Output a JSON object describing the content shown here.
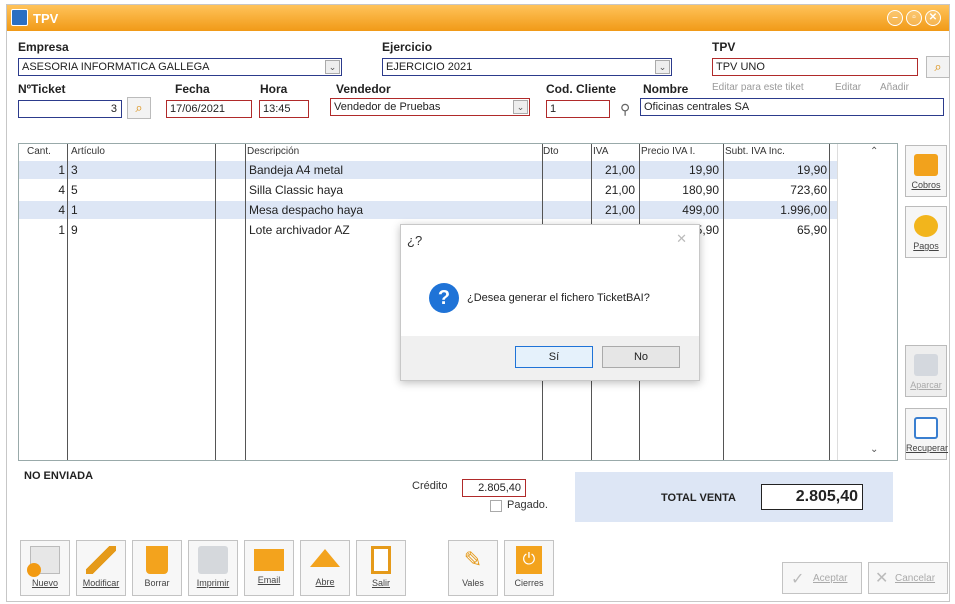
{
  "window": {
    "title": "TPV"
  },
  "header": {
    "empresa_label": "Empresa",
    "empresa_value": "ASESORIA INFORMATICA GALLEGA",
    "ejercicio_label": "Ejercicio",
    "ejercicio_value": "EJERCICIO 2021",
    "tpv_label": "TPV",
    "tpv_value": "TPV UNO",
    "ticket_label": "NºTicket",
    "ticket_value": "3",
    "fecha_label": "Fecha",
    "fecha_value": "17/06/2021",
    "hora_label": "Hora",
    "hora_value": "13:45",
    "vendedor_label": "Vendedor",
    "vendedor_value": "Vendedor de Pruebas",
    "cod_cliente_label": "Cod. Cliente",
    "cod_cliente_value": "1",
    "nombre_label": "Nombre",
    "nombre_value": "Oficinas centrales SA",
    "editar_tiket_label": "Editar para este tiket",
    "editar_label": "Editar",
    "anadir_label": "Añadir"
  },
  "table": {
    "headers": [
      "Cant.",
      "Artículo",
      "Descripción",
      "Dto",
      "IVA",
      "Precio IVA I.",
      "Subt. IVA Inc."
    ],
    "rows": [
      {
        "cant": "1",
        "articulo": "3",
        "descripcion": "Bandeja A4 metal",
        "dto": "",
        "iva": "21,00",
        "precio": "19,90",
        "subtotal": "19,90"
      },
      {
        "cant": "4",
        "articulo": "5",
        "descripcion": "Silla Classic haya",
        "dto": "",
        "iva": "21,00",
        "precio": "180,90",
        "subtotal": "723,60"
      },
      {
        "cant": "4",
        "articulo": "1",
        "descripcion": "Mesa despacho haya",
        "dto": "",
        "iva": "21,00",
        "precio": "499,00",
        "subtotal": "1.996,00"
      },
      {
        "cant": "1",
        "articulo": "9",
        "descripcion": "Lote archivador AZ",
        "dto": "",
        "iva": "",
        "precio": "5,90",
        "subtotal": "65,90"
      }
    ]
  },
  "side_buttons": {
    "cobros": "Cobros",
    "pagos": "Pagos",
    "aparcar": "Aparcar",
    "recuperar": "Recuperar"
  },
  "footer": {
    "status": "NO ENVIADA",
    "credito_label": "Crédito",
    "credito_value": "2.805,40",
    "pagado_label": "Pagado.",
    "total_label": "TOTAL VENTA",
    "total_value": "2.805,40"
  },
  "toolbar": {
    "nuevo": "Nuevo",
    "modificar": "Modificar",
    "borrar": "Borrar",
    "imprimir": "Imprimir",
    "email": "Email",
    "abre": "Abre",
    "salir": "Salir",
    "vales": "Vales",
    "cierres": "Cierres",
    "aceptar": "Aceptar",
    "cancelar": "Cancelar"
  },
  "dialog": {
    "title": "¿?",
    "message": "¿Desea generar el fichero TicketBAI?",
    "yes": "Sí",
    "no": "No"
  },
  "colors": {
    "titlebar": "#f19a17",
    "accent_blue": "#1f73d7",
    "row_alt": "#dde6f5"
  }
}
